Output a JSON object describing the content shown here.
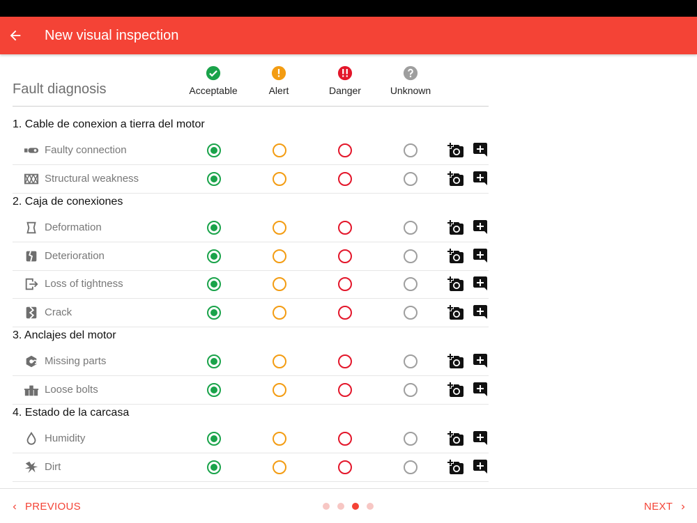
{
  "colors": {
    "brand": "#f44336",
    "acceptable": "#1aa34a",
    "alert": "#f39c12",
    "danger": "#e3162a",
    "unknown": "#9e9e9e"
  },
  "app_bar": {
    "title": "New visual inspection",
    "back_icon": "arrow-left-icon"
  },
  "header": {
    "title": "Fault diagnosis",
    "columns": [
      {
        "label": "Acceptable",
        "icon": "check-circle-icon"
      },
      {
        "label": "Alert",
        "icon": "exclamation-circle-icon"
      },
      {
        "label": "Danger",
        "icon": "double-exclamation-circle-icon"
      },
      {
        "label": "Unknown",
        "icon": "question-circle-icon"
      }
    ]
  },
  "sections": [
    {
      "title": "1. Cable de conexion a tierra del motor",
      "items": [
        {
          "label": "Faulty connection",
          "icon": "plug-icon",
          "selected": "Acceptable"
        },
        {
          "label": "Structural weakness",
          "icon": "truss-icon",
          "selected": "Acceptable"
        }
      ]
    },
    {
      "title": "2. Caja de conexiones",
      "items": [
        {
          "label": "Deformation",
          "icon": "deformation-icon",
          "selected": "Acceptable"
        },
        {
          "label": "Deterioration",
          "icon": "deterioration-icon",
          "selected": "Acceptable"
        },
        {
          "label": "Loss of tightness",
          "icon": "exit-box-icon",
          "selected": "Acceptable"
        },
        {
          "label": "Crack",
          "icon": "crack-icon",
          "selected": "Acceptable"
        }
      ]
    },
    {
      "title": "3. Anclajes del motor",
      "items": [
        {
          "label": "Missing parts",
          "icon": "missing-part-icon",
          "selected": "Acceptable"
        },
        {
          "label": "Loose bolts",
          "icon": "bolts-icon",
          "selected": "Acceptable"
        }
      ]
    },
    {
      "title": "4. Estado de la carcasa",
      "items": [
        {
          "label": "Humidity",
          "icon": "water-drop-icon",
          "selected": "Acceptable"
        },
        {
          "label": "Dirt",
          "icon": "dirt-icon",
          "selected": "Acceptable"
        }
      ]
    }
  ],
  "actions": {
    "photo_icon": "add-photo-icon",
    "comment_icon": "add-comment-icon"
  },
  "footer": {
    "previous": "PREVIOUS",
    "next": "NEXT",
    "page_count": 4,
    "active_page": 3
  }
}
